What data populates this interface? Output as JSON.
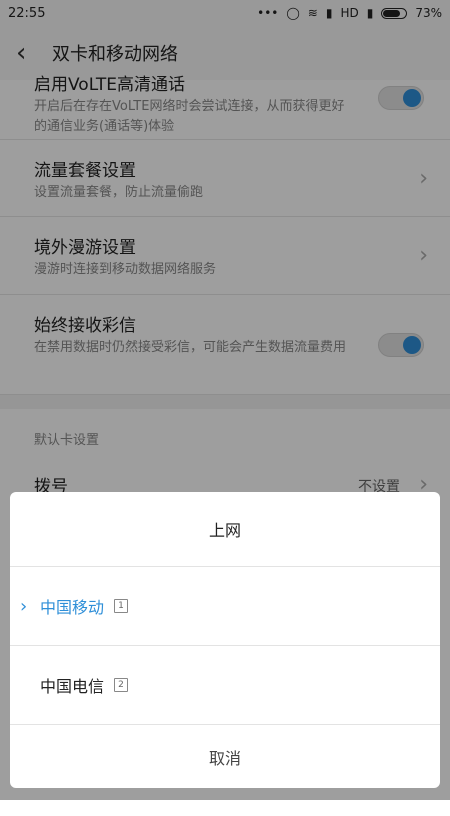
{
  "status_bar": {
    "time": "22:55",
    "network_label": "HD",
    "battery_pct": "73%",
    "icons": [
      "dots-icon",
      "circle-icon",
      "wifi-icon",
      "signal-icon",
      "signal-icon",
      "battery-icon"
    ]
  },
  "header": {
    "title": "双卡和移动网络"
  },
  "list": {
    "volte_title": "启用VoLTE高清通话",
    "volte_sub": "开启后在存在VoLTE网络时会尝试连接，从而获得更好的通信业务(通话等)体验",
    "volte_on": true,
    "data_plan_title": "流量套餐设置",
    "data_plan_sub": "设置流量套餐，防止流量偷跑",
    "roaming_title": "境外漫游设置",
    "roaming_sub": "漫游时连接到移动数据网络服务",
    "mms_title": "始终接收彩信",
    "mms_sub": "在禁用数据时仍然接受彩信，可能会产生数据流量费用",
    "mms_on": true,
    "default_section": "默认卡设置",
    "dial_title": "拨号",
    "dial_value": "不设置"
  },
  "dialog": {
    "title": "上网",
    "options": [
      {
        "label": "中国移动",
        "sim": "1",
        "selected": true
      },
      {
        "label": "中国电信",
        "sim": "2",
        "selected": false
      }
    ],
    "cancel": "取消"
  },
  "colors": {
    "accent": "#2f8fd8"
  }
}
